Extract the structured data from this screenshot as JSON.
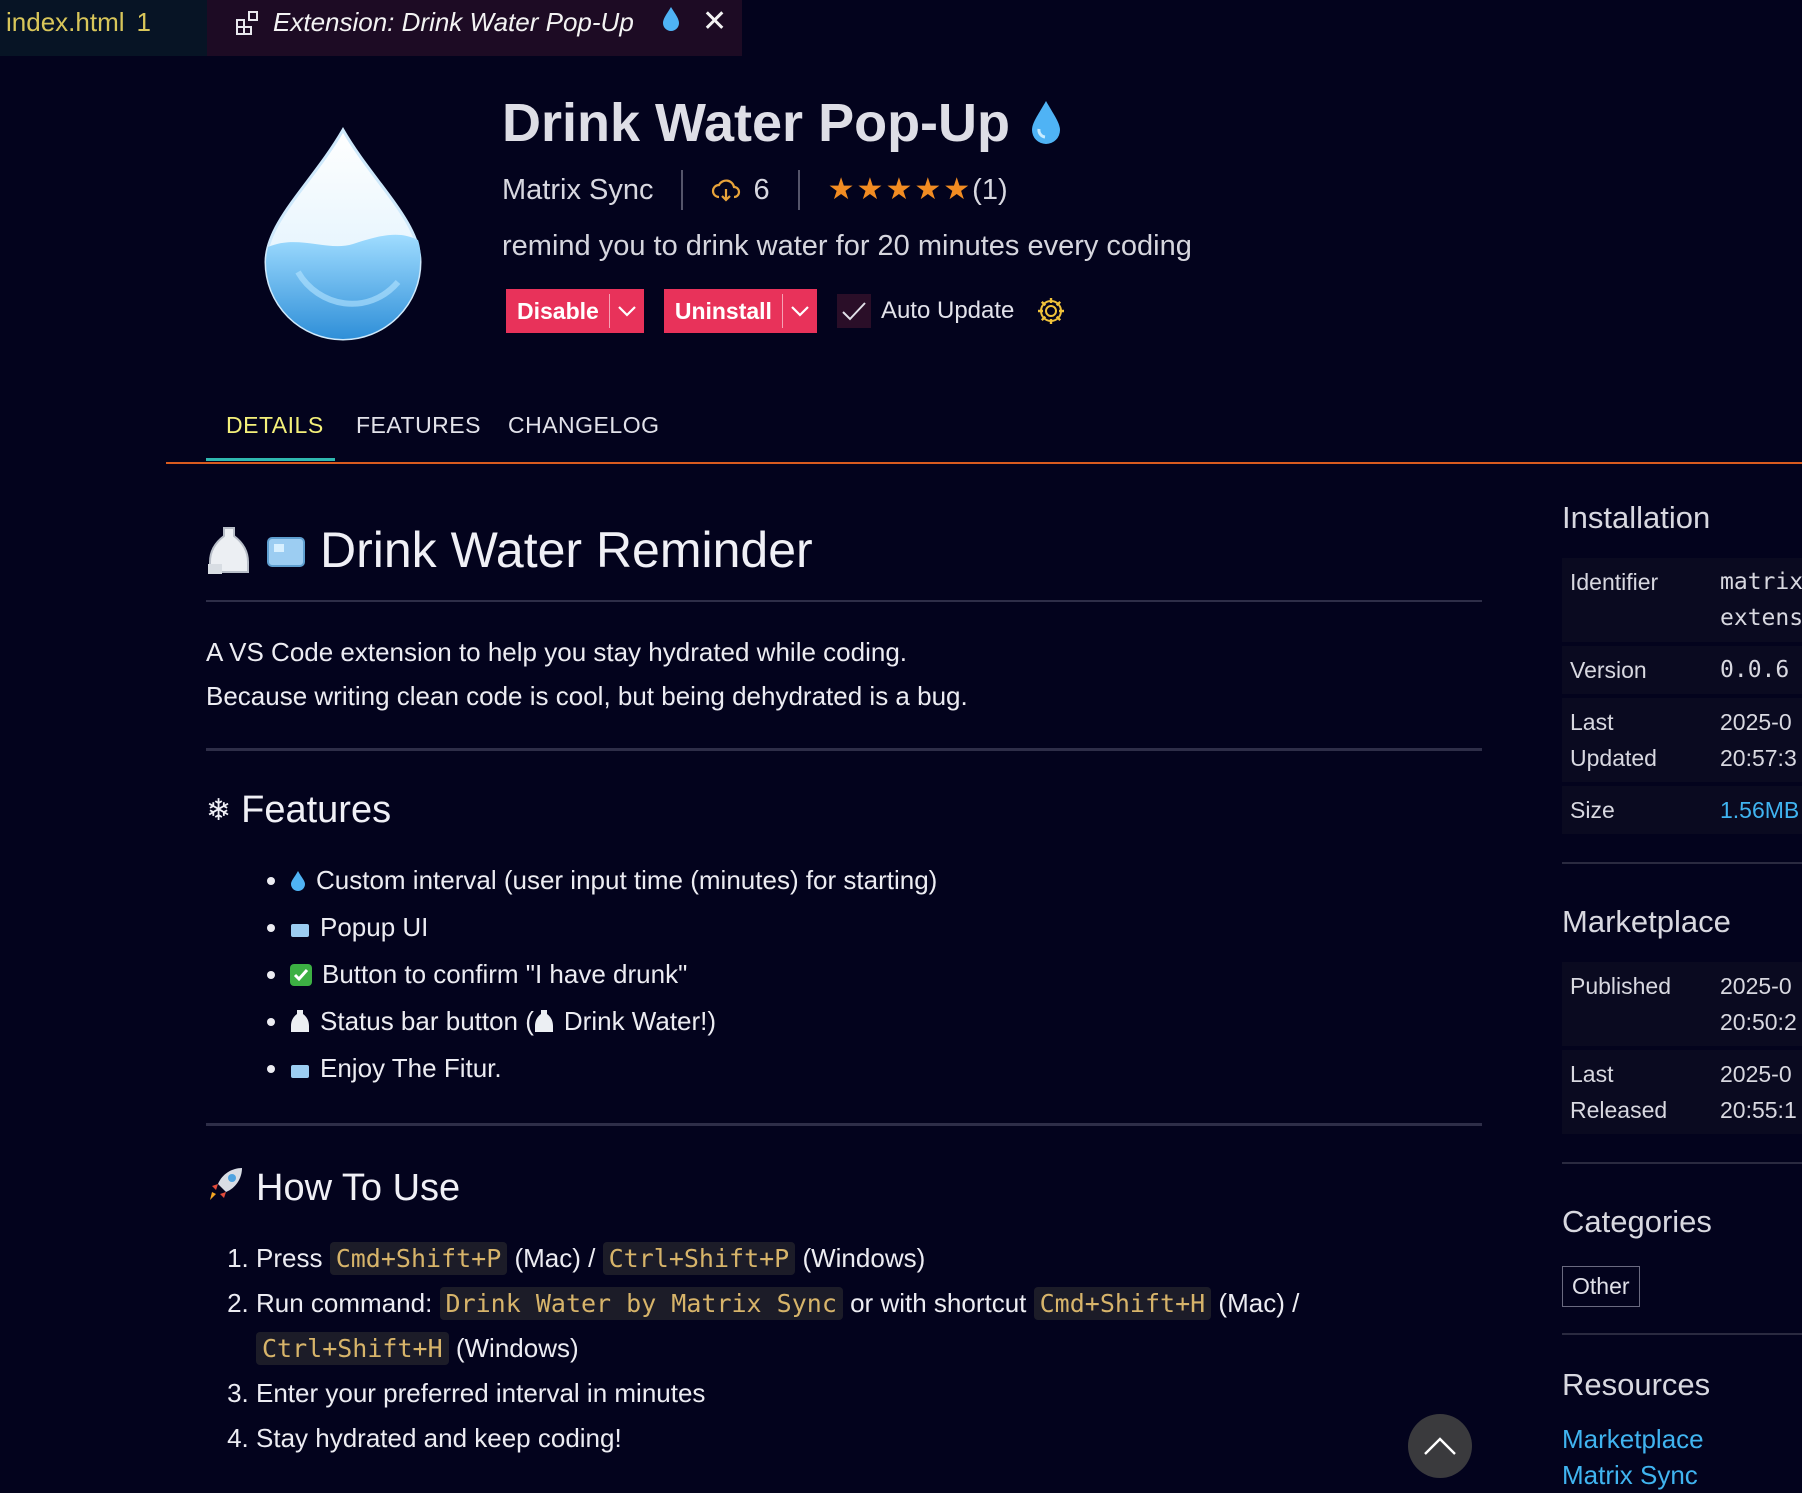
{
  "tabs": [
    {
      "label": "index.html",
      "badge": "1"
    },
    {
      "label": "Extension: Drink Water Pop-Up",
      "close": "✕"
    }
  ],
  "header": {
    "title": "Drink Water Pop-Up",
    "publisher": "Matrix Sync",
    "installs": "6",
    "rating_stars": 5,
    "rating_count": "(1)",
    "description": "remind you to drink water for 20 minutes every coding",
    "disable_label": "Disable",
    "uninstall_label": "Uninstall",
    "auto_update_label": "Auto Update"
  },
  "nav": {
    "details": "DETAILS",
    "features": "FEATURES",
    "changelog": "CHANGELOG"
  },
  "readme": {
    "h1": "Drink Water Reminder",
    "intro1": "A VS Code extension to help you stay hydrated while coding.",
    "intro2": "Because writing clean code is cool, but being dehydrated is a bug.",
    "features_heading": "Features",
    "features": [
      "Custom interval (user input time (minutes) for starting)",
      "Popup UI",
      "Button to confirm \"I have drunk\"",
      "Status bar button (",
      "Drink Water!)",
      "Enjoy The Fitur."
    ],
    "howto_heading": "How To Use",
    "step1_a": "Press ",
    "step1_code1": "Cmd+Shift+P",
    "step1_b": " (Mac) / ",
    "step1_code2": "Ctrl+Shift+P",
    "step1_c": " (Windows)",
    "step2_a": "Run command: ",
    "step2_code1": "Drink Water by Matrix Sync",
    "step2_b": " or with shortcut ",
    "step2_code2": "Cmd+Shift+H",
    "step2_c": " (Mac) / ",
    "step2_code3": "Ctrl+Shift+H",
    "step2_d": " (Windows)",
    "step3": "Enter your preferred interval in minutes",
    "step4": "Stay hydrated and keep coding!"
  },
  "sidebar": {
    "installation": {
      "heading": "Installation",
      "identifier_k": "Identifier",
      "identifier_v1": "matrix",
      "identifier_v2": "extens",
      "version_k": "Version",
      "version_v": "0.0.6",
      "updated_k1": "Last",
      "updated_k2": "Updated",
      "updated_v1": "2025-0",
      "updated_v2": "20:57:3",
      "size_k": "Size",
      "size_v": "1.56MB"
    },
    "marketplace": {
      "heading": "Marketplace",
      "published_k": "Published",
      "published_v1": "2025-0",
      "published_v2": "20:50:2",
      "released_k1": "Last",
      "released_k2": "Released",
      "released_v1": "2025-0",
      "released_v2": "20:55:1"
    },
    "categories": {
      "heading": "Categories",
      "chip": "Other"
    },
    "resources": {
      "heading": "Resources",
      "link1": "Marketplace",
      "link2": "Matrix Sync"
    }
  },
  "colors": {
    "background": "#03031d",
    "button": "#e8325a",
    "accent": "#f4f07a",
    "star": "#f28c22",
    "link": "#40b4f0"
  }
}
